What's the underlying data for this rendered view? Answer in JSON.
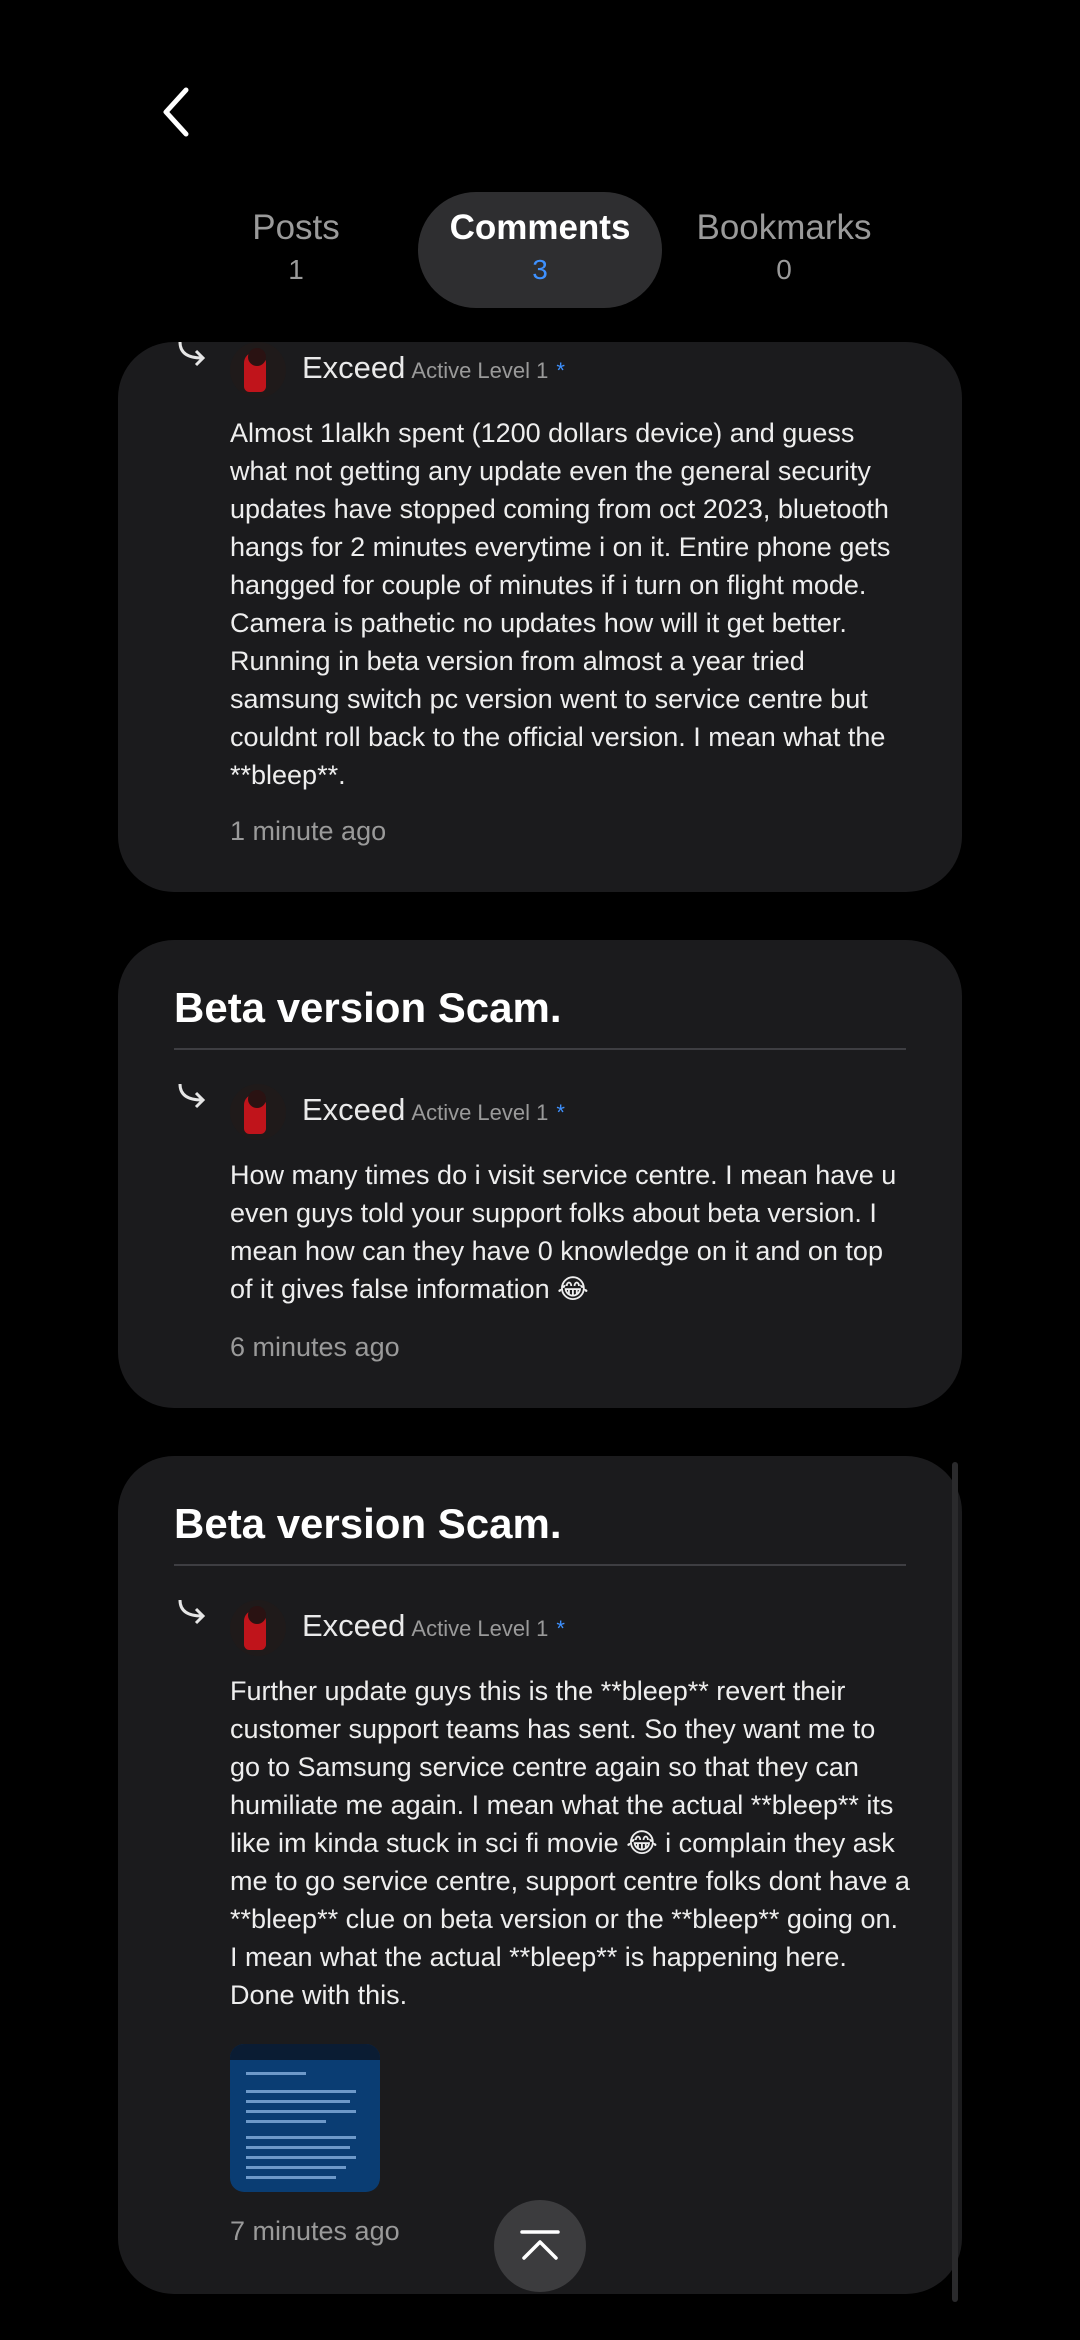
{
  "tabs": [
    {
      "label": "Posts",
      "count": "1"
    },
    {
      "label": "Comments",
      "count": "3"
    },
    {
      "label": "Bookmarks",
      "count": "0"
    }
  ],
  "comments": [
    {
      "user": "Exceed",
      "level": "Active Level 1",
      "star": "*",
      "text": "Almost 1lalkh spent (1200 dollars device) and guess what not getting any update even the general security updates have stopped coming from oct 2023, bluetooth hangs for 2 minutes everytime i on it. Entire phone gets hangged for couple of minutes if i turn on flight mode. Camera is pathetic no updates how will it get better. Running in beta version from almost a year tried samsung switch pc version went to service centre but couldnt roll back to the official version. I mean what the **bleep**.",
      "time": "1 minute ago"
    },
    {
      "title": "Beta version Scam.",
      "user": "Exceed",
      "level": "Active Level 1",
      "star": "*",
      "text": "How many times do i visit service centre. I mean have u even guys told your support folks about beta version. I mean how can they have 0 knowledge on it and on top of it gives false information 😂",
      "time": "6 minutes ago"
    },
    {
      "title": "Beta version Scam.",
      "user": "Exceed",
      "level": "Active Level 1",
      "star": "*",
      "text": "Further update guys this is the **bleep** revert their customer support teams has sent. So they want me to go to Samsung service centre again so that they can humiliate me again. I mean what the actual **bleep** its like im kinda stuck in sci fi movie 😂 i complain they ask me to go service centre, support centre folks dont have a **bleep** clue on beta version or the **bleep** going on. I mean what the actual **bleep** is happening here. Done with this.",
      "time": "7 minutes ago"
    }
  ],
  "icons": {
    "back": "chevron-left-icon",
    "reply": "reply-arrow-icon",
    "scroll_top": "scroll-to-top-icon"
  },
  "colors": {
    "background": "#000000",
    "card": "#1b1b1d",
    "accent": "#3e91ff",
    "active_tab": "#2e2e30"
  }
}
